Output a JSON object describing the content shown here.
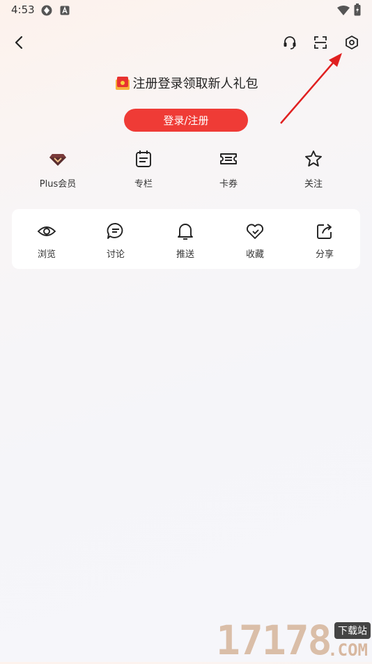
{
  "status_bar": {
    "time": "4:53"
  },
  "promo": {
    "text": "注册登录领取新人礼包"
  },
  "login_button": {
    "label": "登录/注册"
  },
  "quick_items": [
    {
      "label": "Plus会员",
      "icon": "diamond-icon"
    },
    {
      "label": "专栏",
      "icon": "calendar-icon"
    },
    {
      "label": "卡券",
      "icon": "ticket-icon"
    },
    {
      "label": "关注",
      "icon": "star-icon"
    }
  ],
  "card_items": [
    {
      "label": "浏览",
      "icon": "eye-icon"
    },
    {
      "label": "讨论",
      "icon": "chat-icon"
    },
    {
      "label": "推送",
      "icon": "bell-icon"
    },
    {
      "label": "收藏",
      "icon": "heart-icon"
    },
    {
      "label": "分享",
      "icon": "share-icon"
    }
  ],
  "watermark": {
    "digits": "17178",
    "tag": "下载站",
    "domain": ".COM"
  },
  "colors": {
    "accent": "#ef3b36",
    "arrow": "#e02020",
    "card": "#ffffff"
  }
}
